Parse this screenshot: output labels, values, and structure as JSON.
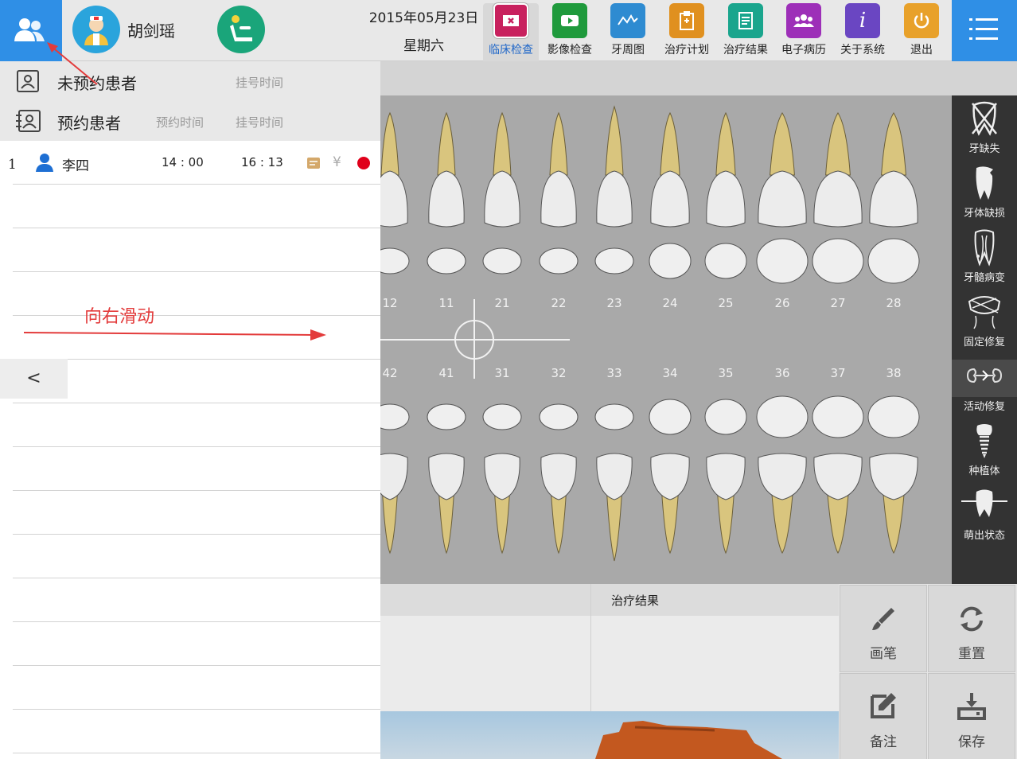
{
  "header": {
    "doctor_name": "胡剑瑶",
    "date": "2015年05月23日",
    "weekday": "星期六",
    "toolbar": [
      {
        "label": "临床检查",
        "icon": "clinical-exam-icon",
        "color": "#c8215e",
        "active": true
      },
      {
        "label": "影像检查",
        "icon": "imaging-icon",
        "color": "#1f9a3c"
      },
      {
        "label": "牙周图",
        "icon": "periodontal-chart-icon",
        "color": "#2e8bd1"
      },
      {
        "label": "治疗计划",
        "icon": "treatment-plan-icon",
        "color": "#e0901f"
      },
      {
        "label": "治疗结果",
        "icon": "treatment-result-icon",
        "color": "#1aa58d"
      },
      {
        "label": "电子病历",
        "icon": "emr-icon",
        "color": "#9d2fb8"
      },
      {
        "label": "关于系统",
        "icon": "info-icon",
        "color": "#6a46c2"
      },
      {
        "label": "退出",
        "icon": "power-icon",
        "color": "#e8a12a"
      }
    ]
  },
  "panel": {
    "unscheduled": {
      "title": "未预约患者",
      "col_register": "挂号时间"
    },
    "scheduled": {
      "title": "预约患者",
      "col_appointment": "预约时间",
      "col_register": "挂号时间"
    },
    "patients": [
      {
        "index": "1",
        "name": "李四",
        "appointment_time": "14 : 00",
        "register_time": "16 : 13",
        "currency": "¥",
        "status_color": "#e0001b"
      }
    ],
    "collapse_symbol": "<",
    "annotation_text": "向右滑动"
  },
  "tooth_numbers": {
    "upper": [
      "12",
      "11",
      "21",
      "22",
      "23",
      "24",
      "25",
      "26",
      "27",
      "28"
    ],
    "lower": [
      "42",
      "41",
      "31",
      "32",
      "33",
      "34",
      "35",
      "36",
      "37",
      "38"
    ]
  },
  "right_tools": [
    {
      "label": "牙缺失",
      "icon": "missing-tooth-icon"
    },
    {
      "label": "牙体缺损",
      "icon": "tooth-defect-icon"
    },
    {
      "label": "牙髓病变",
      "icon": "pulp-lesion-icon"
    },
    {
      "label": "固定修复",
      "icon": "fixed-restoration-icon"
    },
    {
      "label": "活动修复",
      "icon": "removable-restoration-icon"
    },
    {
      "label": "种植体",
      "icon": "implant-icon"
    },
    {
      "label": "萌出状态",
      "icon": "eruption-state-icon"
    }
  ],
  "bottom": {
    "treatment_result_title": "治疗结果",
    "buttons": [
      {
        "label": "画笔",
        "icon": "brush-icon"
      },
      {
        "label": "重置",
        "icon": "reset-icon"
      },
      {
        "label": "备注",
        "icon": "note-icon"
      },
      {
        "label": "保存",
        "icon": "save-icon"
      }
    ]
  }
}
